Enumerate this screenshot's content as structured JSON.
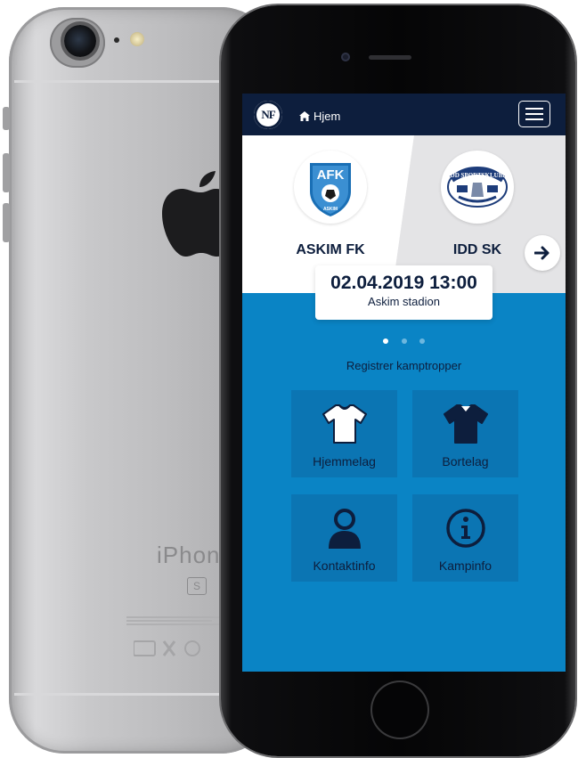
{
  "colors": {
    "navbar": "#0d1e3d",
    "accent": "#0a84c5",
    "tile": "#0b75b3",
    "match_background": "#e8e8ea",
    "text_dark": "#0d1e3d"
  },
  "device_back": {
    "model_text": "iPhone",
    "model_badge": "S"
  },
  "header": {
    "logo_text": "NF",
    "home_icon": "home-icon",
    "home_label": "Hjem",
    "menu_icon": "hamburger-menu-icon"
  },
  "match": {
    "home_team": {
      "name": "ASKIM FK",
      "logo_text": "AFK",
      "logo_subtext": "ASKIM"
    },
    "away_team": {
      "name": "IDD SK",
      "logo_text": "IDD SPORTSKLUBB"
    },
    "datetime": "02.04.2019 13:00",
    "venue": "Askim stadion",
    "next_icon": "arrow-right-icon",
    "carousel_dots": 3,
    "active_dot": 0
  },
  "section_title": "Registrer kamptropper",
  "tiles": [
    {
      "label": "Hjemmelag",
      "icon": "home-jersey-icon"
    },
    {
      "label": "Bortelag",
      "icon": "away-jersey-icon"
    },
    {
      "label": "Kontaktinfo",
      "icon": "person-icon"
    },
    {
      "label": "Kampinfo",
      "icon": "info-icon"
    }
  ]
}
